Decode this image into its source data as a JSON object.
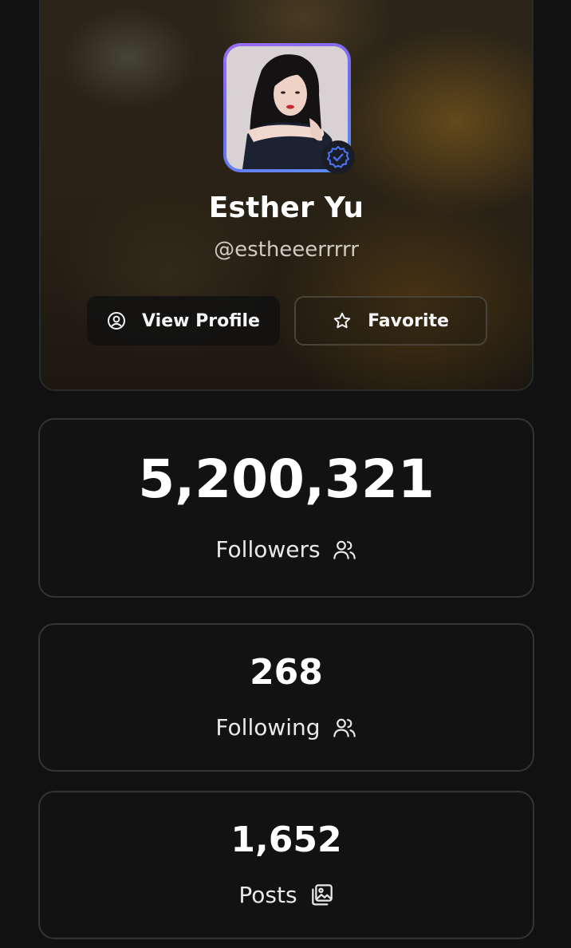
{
  "profile": {
    "name": "Esther Yu",
    "handle": "@estheeerrrrr",
    "avatar_alt": "profile photo",
    "verified": true
  },
  "actions": {
    "view_profile_label": "View Profile",
    "view_profile_icon": "user-circle-icon",
    "favorite_label": "Favorite",
    "favorite_icon": "star-icon"
  },
  "stats": {
    "followers": {
      "value": "5,200,321",
      "label": "Followers",
      "icon": "users-icon"
    },
    "following": {
      "value": "268",
      "label": "Following",
      "icon": "users-icon"
    },
    "posts": {
      "value": "1,652",
      "label": "Posts",
      "icon": "gallery-icon"
    }
  },
  "colors": {
    "background": "#111111",
    "card_border": "#343434",
    "avatar_gradient_start": "#9c6cf2",
    "avatar_gradient_end": "#5c8df2",
    "verified_badge": "#4a6fe8"
  }
}
